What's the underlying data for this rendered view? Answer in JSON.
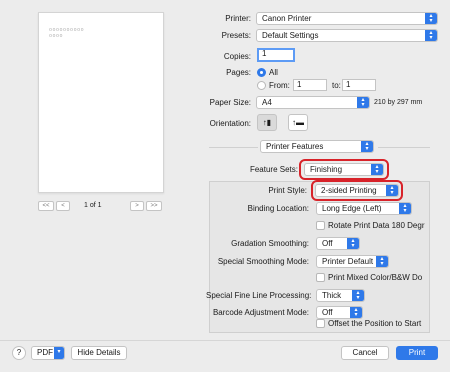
{
  "preview": {
    "sample_line1": "oooooooooo",
    "sample_line2": "oooo",
    "page_label": "1 of 1",
    "first_label": "<<",
    "prev_label": "<",
    "next_label": ">",
    "last_label": ">>"
  },
  "printer": {
    "label": "Printer:",
    "value": "Canon Printer"
  },
  "presets": {
    "label": "Presets:",
    "value": "Default Settings"
  },
  "copies": {
    "label": "Copies:",
    "value": "1"
  },
  "pages": {
    "label": "Pages:",
    "all_label": "All",
    "from_label": "From:",
    "from_value": "1",
    "to_label": "to:",
    "to_value": "1"
  },
  "paper_size": {
    "label": "Paper Size:",
    "value": "A4",
    "dimensions": "210 by 297 mm"
  },
  "orientation": {
    "label": "Orientation:",
    "portrait_glyph": "↑▮",
    "landscape_glyph": "↑▬"
  },
  "section_popup": {
    "value": "Printer Features"
  },
  "feature_sets": {
    "label": "Feature Sets:",
    "value": "Finishing"
  },
  "print_style": {
    "label": "Print Style:",
    "value": "2-sided Printing"
  },
  "binding_location": {
    "label": "Binding Location:",
    "value": "Long Edge (Left)"
  },
  "rotate_180": {
    "label": "Rotate Print Data 180 Degr"
  },
  "gradation_smoothing": {
    "label": "Gradation Smoothing:",
    "value": "Off"
  },
  "special_smoothing": {
    "label": "Special Smoothing Mode:",
    "value": "Printer Default"
  },
  "print_mixed": {
    "label": "Print Mixed Color/B&W Do"
  },
  "fine_line": {
    "label": "Special Fine Line Processing:",
    "value": "Thick"
  },
  "barcode": {
    "label": "Barcode Adjustment Mode:",
    "value": "Off"
  },
  "offset_position": {
    "label": "Offset the Position to Start"
  },
  "bottom_bar": {
    "help_label": "?",
    "pdf_label": "PDF",
    "hide_details_label": "Hide Details",
    "cancel_label": "Cancel",
    "print_label": "Print"
  },
  "colors": {
    "accent": "#2f79e9",
    "highlight": "#d8232a"
  },
  "icons": {
    "chevron": "chevron-updown-icon"
  }
}
